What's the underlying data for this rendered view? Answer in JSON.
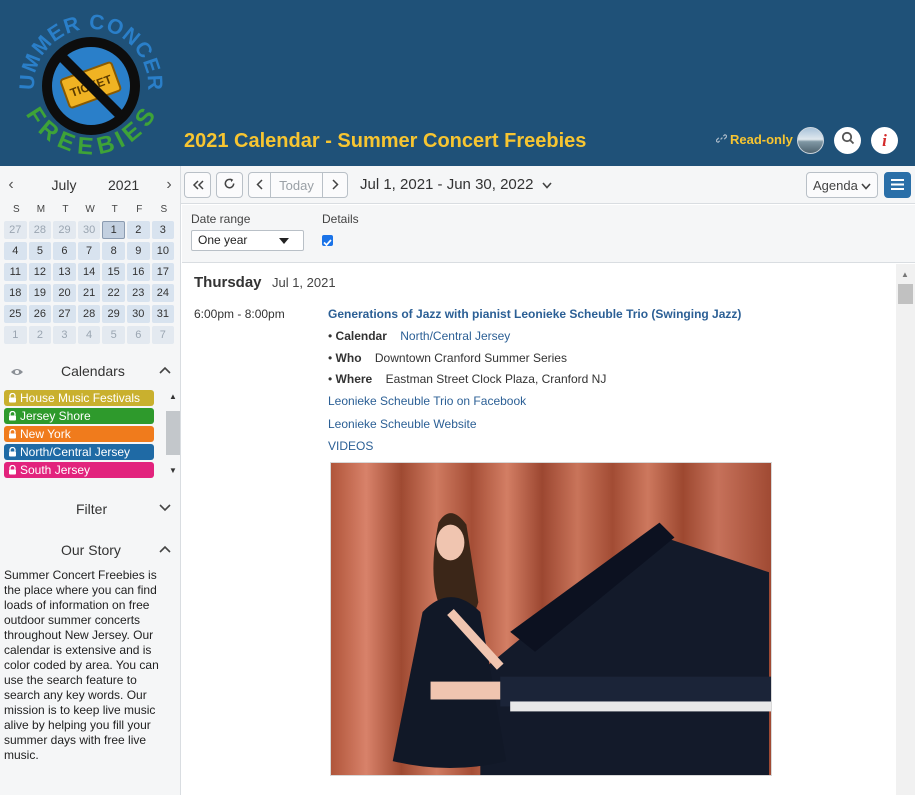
{
  "header": {
    "title": "2021 Calendar - Summer Concert Freebies",
    "readonly_label": "Read-only",
    "logo_text_top": "SUMMER CONCERT",
    "logo_text_bottom": "FREEBIES",
    "logo_ticket_text": "TICKET"
  },
  "mini_calendar": {
    "month": "July",
    "year": "2021",
    "dow": [
      "S",
      "M",
      "T",
      "W",
      "T",
      "F",
      "S"
    ],
    "weeks": [
      [
        "27",
        "28",
        "29",
        "30",
        "1",
        "2",
        "3"
      ],
      [
        "4",
        "5",
        "6",
        "7",
        "8",
        "9",
        "10"
      ],
      [
        "11",
        "12",
        "13",
        "14",
        "15",
        "16",
        "17"
      ],
      [
        "18",
        "19",
        "20",
        "21",
        "22",
        "23",
        "24"
      ],
      [
        "25",
        "26",
        "27",
        "28",
        "29",
        "30",
        "31"
      ],
      [
        "1",
        "2",
        "3",
        "4",
        "5",
        "6",
        "7"
      ]
    ],
    "today": "1"
  },
  "calendars": {
    "title": "Calendars",
    "items": [
      {
        "label": "House Music Festivals",
        "color": "#c9b02e"
      },
      {
        "label": "Jersey Shore",
        "color": "#2e9a2c"
      },
      {
        "label": "New York",
        "color": "#f07b1c"
      },
      {
        "label": "North/Central Jersey",
        "color": "#1f6aa5"
      },
      {
        "label": "South Jersey",
        "color": "#e2237d"
      }
    ]
  },
  "filter": {
    "title": "Filter"
  },
  "story": {
    "title": "Our Story",
    "text": "Summer Concert Freebies is the place where you can find loads of information on free outdoor summer concerts throughout New Jersey.  Our calendar is extensive and is color coded by area. You can use the search feature to search any key words. Our mission is to keep live music alive by helping you fill your summer days with free live music."
  },
  "toolbar": {
    "today_label": "Today",
    "range_label": "Jul 1, 2021 - Jun 30, 2022",
    "view_label": "Agenda"
  },
  "options": {
    "date_range_label": "Date range",
    "date_range_value": "One year",
    "details_label": "Details",
    "details_checked": true
  },
  "agenda": {
    "day_name": "Thursday",
    "day_date": "Jul 1, 2021",
    "event": {
      "time": "6:00pm - 8:00pm",
      "title": "Generations of Jazz with pianist Leonieke Scheuble Trio (Swinging Jazz)",
      "calendar_key": "Calendar",
      "calendar_value": "North/Central Jersey",
      "who_key": "Who",
      "who_value": "Downtown Cranford Summer Series",
      "where_key": "Where",
      "where_value": "Eastman Street Clock Plaza, Cranford NJ",
      "links": [
        "Leonieke Scheuble Trio on Facebook",
        "Leonieke Scheuble Website",
        "VIDEOS"
      ]
    }
  },
  "colors": {
    "header_bg": "#1f5178",
    "title_yellow": "#f7c531",
    "link_blue": "#2b5f95",
    "accent_blue": "#2a6fa8"
  }
}
